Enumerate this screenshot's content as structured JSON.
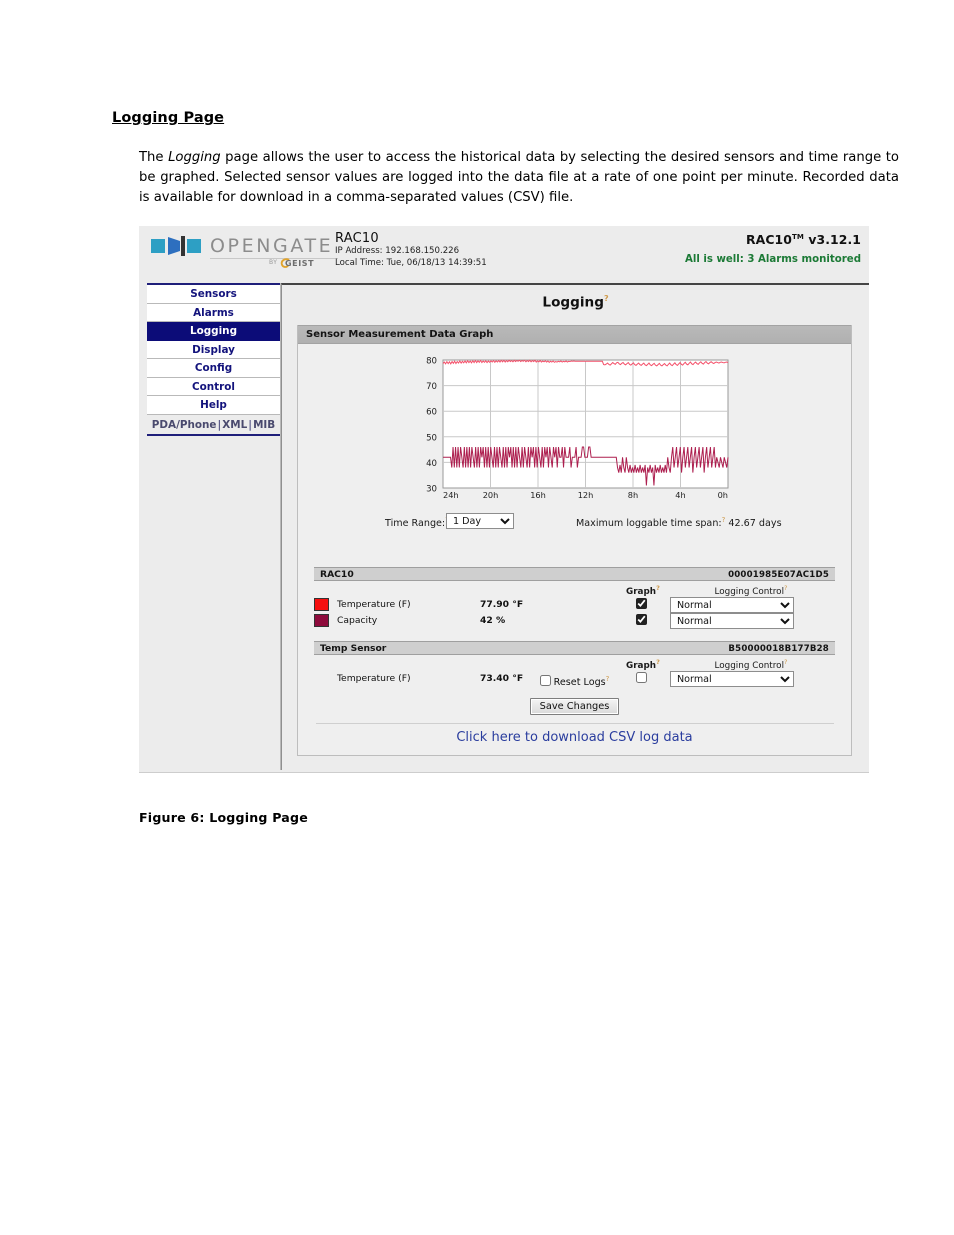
{
  "document": {
    "heading": "Logging Page",
    "paragraph_parts": {
      "a": "The ",
      "b": "Logging",
      "c": " page allows the user to access the historical data by selecting the desired sensors and time range to be graphed.  Selected sensor values are logged into the data file at a rate of one point per minute.  Recorded data is available for download in a comma-separated values (CSV) file."
    },
    "figure_caption": "Figure 6: Logging Page"
  },
  "app": {
    "logo_word": "OPENGATE",
    "logo_by": "BY",
    "logo_geist": "GEIST",
    "device_name": "RAC10",
    "ip_address": "IP Address: 192.168.150.226",
    "local_time": "Local Time: Tue, 06/18/13 14:39:51",
    "version": "RAC10",
    "version_tm": "TM",
    "version_num": " v3.12.1",
    "status": "All is well: 3 Alarms monitored",
    "status_color": "#1c7a36",
    "accent_nav": "#0c0c78",
    "help_marker": "?"
  },
  "sidebar": {
    "items": [
      {
        "label": "Sensors",
        "active": false
      },
      {
        "label": "Alarms",
        "active": false
      },
      {
        "label": "Logging",
        "active": true
      },
      {
        "label": "Display",
        "active": false
      },
      {
        "label": "Config",
        "active": false
      },
      {
        "label": "Control",
        "active": false
      },
      {
        "label": "Help",
        "active": false
      }
    ],
    "sub_links": [
      "PDA/Phone",
      "XML",
      "MIB"
    ]
  },
  "main": {
    "page_title": "Logging",
    "panel_title": "Sensor Measurement Data Graph",
    "time_range_label": "Time Range:",
    "time_range_value": "1 Day",
    "time_range_options": [
      "1 Day"
    ],
    "max_span_label": "Maximum loggable time span:",
    "max_span_value": "42.67 days",
    "col_graph": "Graph",
    "col_logging_control": "Logging Control",
    "reset_logs_label": "Reset Logs",
    "reset_logs_checked": false,
    "save_button": "Save Changes",
    "csv_link": "Click here to download CSV log data"
  },
  "devices": [
    {
      "name": "RAC10",
      "id": "00001985E07AC1D5",
      "sensors": [
        {
          "swatch": "#f50f0f",
          "name": "Temperature (F)",
          "value": "77.90 °F",
          "graph": true,
          "logging": "Normal"
        },
        {
          "swatch": "#8e0b3c",
          "name": "Capacity",
          "value": "42 %",
          "graph": true,
          "logging": "Normal"
        }
      ]
    },
    {
      "name": "Temp Sensor",
      "id": "B50000018B177B28",
      "sensors": [
        {
          "swatch": null,
          "name": "Temperature (F)",
          "value": "73.40 °F",
          "graph": false,
          "logging": "Normal"
        }
      ]
    }
  ],
  "logging_options": [
    "Normal"
  ],
  "chart_data": {
    "type": "line",
    "title": "Sensor Measurement Data Graph",
    "xlabel": "",
    "ylabel": "",
    "ylim": [
      30,
      80
    ],
    "yticks": [
      30,
      40,
      50,
      60,
      70,
      80
    ],
    "xticks": [
      "24h",
      "20h",
      "16h",
      "12h",
      "8h",
      "4h",
      "0h"
    ],
    "xlim": [
      24,
      0
    ],
    "grid": true,
    "legend": "swatches-in-table",
    "series": [
      {
        "name": "Temperature (F)",
        "color": "#f4506a",
        "values": [
          78.6,
          79.2,
          78.5,
          79.4,
          78.6,
          79.3,
          78.5,
          79.4,
          78.7,
          79.5,
          78.6,
          79.4,
          78.8,
          79.6,
          78.8,
          79.5,
          78.9,
          79.6,
          78.9,
          79.7,
          79.0,
          79.6,
          78.9,
          79.7,
          79.0,
          79.8,
          79.0,
          79.7,
          79.1,
          79.8,
          79.0,
          79.6,
          79.1,
          79.7,
          79.0,
          79.6,
          79.1,
          79.7,
          79.2,
          79.8,
          79.1,
          79.7,
          79.2,
          79.8,
          79.2,
          79.9,
          79.3,
          79.9,
          79.2,
          79.8,
          79.3,
          79.9,
          79.4,
          79.8,
          79.3,
          79.9,
          79.4,
          79.8,
          79.5,
          79.9,
          79.4,
          79.8,
          79.5,
          79.9,
          79.3,
          79.8,
          79.4,
          79.9,
          79.3,
          79.8,
          79.4,
          79.9,
          79.2,
          79.7,
          79.3,
          79.8,
          79.2,
          79.6,
          79.3,
          79.7,
          79.2,
          79.6,
          79.1,
          79.5,
          79.2,
          79.6,
          79.1,
          79.4,
          79.2,
          79.5,
          79.3,
          79.6,
          79.2,
          79.5,
          79.3,
          79.6,
          79.2,
          79.5,
          79.4,
          79.6,
          79.5,
          79.6,
          79.5,
          79.5,
          79.5,
          79.5,
          79.5,
          79.5,
          79.5,
          79.5,
          79.5,
          79.5,
          79.5,
          79.5,
          79.5,
          79.5,
          79.5,
          79.5,
          79.5,
          79.5,
          79.5,
          79.5,
          79.5,
          79.5,
          78.2,
          78.1,
          78.4,
          78.8,
          78.3,
          78.0,
          78.5,
          79.0,
          78.6,
          78.3,
          78.9,
          79.1,
          78.5,
          78.2,
          78.7,
          79.0,
          78.4,
          78.1,
          78.6,
          79.0,
          78.3,
          78.0,
          78.5,
          78.9,
          78.2,
          77.9,
          78.4,
          78.8,
          78.2,
          77.9,
          78.4,
          78.8,
          78.1,
          77.8,
          78.3,
          78.8,
          78.1,
          77.8,
          78.3,
          78.7,
          78.0,
          77.7,
          78.2,
          78.7,
          78.0,
          77.7,
          78.2,
          78.6,
          78.0,
          77.7,
          78.3,
          78.8,
          78.1,
          77.8,
          78.4,
          78.9,
          78.2,
          77.9,
          78.5,
          79.0,
          78.3,
          78.0,
          78.6,
          79.1,
          78.4,
          78.1,
          78.7,
          79.2,
          78.5,
          78.2,
          78.8,
          79.2,
          78.6,
          78.3,
          78.9,
          79.3,
          78.7,
          78.4,
          79.0,
          79.4,
          78.8,
          78.5,
          79.0,
          79.3,
          78.9,
          78.6,
          79.0,
          79.2,
          79.0,
          78.8,
          79.1,
          79.2,
          79.0,
          78.9,
          79.1,
          79.2,
          79.0
        ]
      },
      {
        "name": "Capacity",
        "color": "#ad1f4f",
        "values": [
          42,
          42,
          42,
          42,
          42,
          42,
          42,
          38,
          46,
          38,
          46,
          38,
          46,
          38,
          46,
          42,
          38,
          46,
          38,
          46,
          38,
          46,
          38,
          46,
          42,
          38,
          46,
          38,
          46,
          38,
          46,
          42,
          46,
          38,
          46,
          38,
          46,
          38,
          46,
          42,
          38,
          46,
          38,
          46,
          38,
          46,
          42,
          38,
          46,
          38,
          46,
          38,
          46,
          42,
          46,
          38,
          46,
          38,
          46,
          38,
          46,
          42,
          38,
          46,
          38,
          46,
          42,
          38,
          46,
          38,
          46,
          42,
          46,
          38,
          46,
          38,
          46,
          42,
          38,
          46,
          38,
          46,
          42,
          46,
          38,
          46,
          42,
          38,
          46,
          42,
          46,
          38,
          46,
          42,
          42,
          46,
          38,
          46,
          42,
          42,
          42,
          46,
          38,
          42,
          42,
          42,
          46,
          38,
          42,
          42,
          42,
          46,
          46,
          42,
          42,
          42,
          46,
          46,
          42,
          42,
          42,
          42,
          42,
          42,
          42,
          42,
          42,
          42,
          42,
          42,
          42,
          42,
          42,
          42,
          42,
          42,
          42,
          42,
          42,
          38,
          36,
          39,
          36,
          42,
          38,
          36,
          42,
          38,
          36,
          39,
          36,
          38,
          36,
          39,
          36,
          38,
          36,
          39,
          36,
          38,
          36,
          39,
          31,
          38,
          36,
          39,
          36,
          38,
          31,
          39,
          36,
          38,
          36,
          39,
          36,
          38,
          36,
          39,
          36,
          42,
          38,
          36,
          42,
          46,
          38,
          42,
          46,
          38,
          42,
          46,
          36,
          42,
          46,
          38,
          42,
          46,
          38,
          42,
          46,
          36,
          42,
          46,
          38,
          42,
          46,
          38,
          42,
          46,
          36,
          42,
          46,
          38,
          42,
          46,
          38,
          42,
          46,
          38,
          42,
          40,
          38,
          42,
          40,
          38,
          42,
          40,
          38,
          42
        ]
      }
    ]
  }
}
